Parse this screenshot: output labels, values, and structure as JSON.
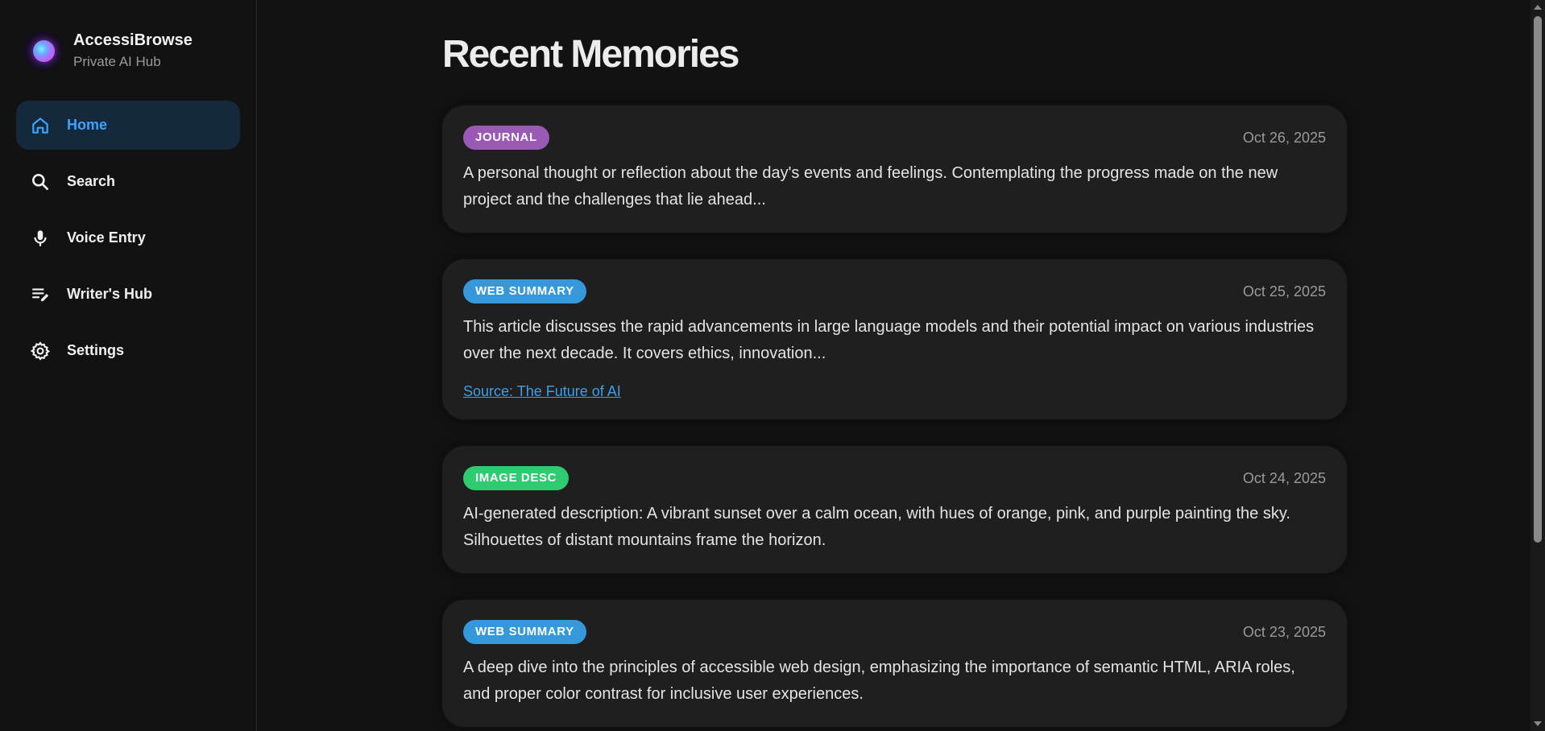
{
  "brand": {
    "name": "AccessiBrowse",
    "subtitle": "Private AI Hub"
  },
  "nav": {
    "items": [
      {
        "label": "Home",
        "icon": "home-icon",
        "active": true
      },
      {
        "label": "Search",
        "icon": "search-icon",
        "active": false
      },
      {
        "label": "Voice Entry",
        "icon": "microphone-icon",
        "active": false
      },
      {
        "label": "Writer's Hub",
        "icon": "edit-notes-icon",
        "active": false
      },
      {
        "label": "Settings",
        "icon": "gear-icon",
        "active": false
      }
    ]
  },
  "main": {
    "title": "Recent Memories",
    "memories": [
      {
        "tag": "JOURNAL",
        "tag_color": "#9b59b6",
        "date": "Oct 26, 2025",
        "text": "A personal thought or reflection about the day's events and feelings. Contemplating the progress made on the new project and the challenges that lie ahead..."
      },
      {
        "tag": "WEB SUMMARY",
        "tag_color": "#3498db",
        "date": "Oct 25, 2025",
        "text": "This article discusses the rapid advancements in large language models and their potential impact on various industries over the next decade. It covers ethics, innovation...",
        "source": "Source: The Future of AI"
      },
      {
        "tag": "IMAGE DESC",
        "tag_color": "#2ecc71",
        "date": "Oct 24, 2025",
        "text": "AI-generated description: A vibrant sunset over a calm ocean, with hues of orange, pink, and purple painting the sky. Silhouettes of distant mountains frame the horizon."
      },
      {
        "tag": "WEB SUMMARY",
        "tag_color": "#3498db",
        "date": "Oct 23, 2025",
        "text": "A deep dive into the principles of accessible web design, emphasizing the importance of semantic HTML, ARIA roles, and proper color contrast for inclusive user experiences."
      }
    ]
  },
  "colors": {
    "accent": "#3ea2ff",
    "background": "#121212",
    "card": "#1f1f1f",
    "active_nav_bg": "#14293b"
  }
}
